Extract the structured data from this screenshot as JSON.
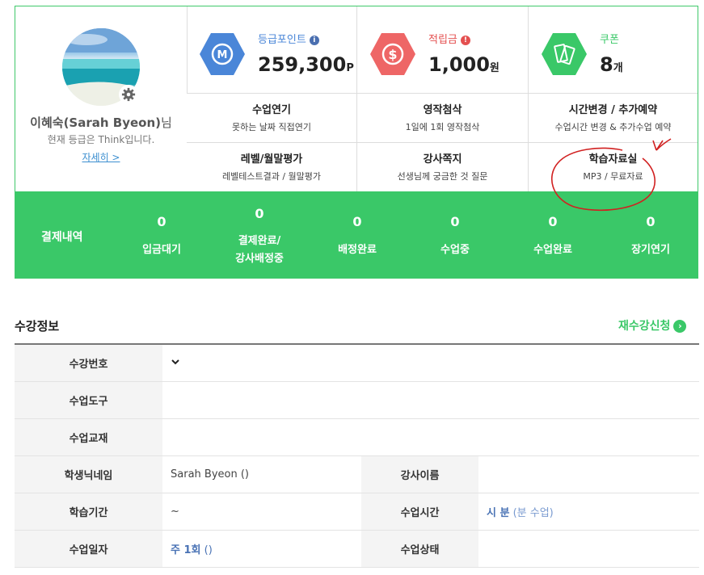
{
  "profile": {
    "name": "이혜숙(Sarah Byeon)",
    "name_suffix": "님",
    "grade_text": "현재 등급은 Think입니다.",
    "detail_link": "자세히 >"
  },
  "stats": [
    {
      "label": "등급포인트",
      "value": "259,300",
      "unit": "P",
      "icon": "m-hexagon-icon",
      "color": "#4a86d8",
      "label_color": "#4a86d8"
    },
    {
      "label": "적립금",
      "value": "1,000",
      "unit": "원",
      "icon": "dollar-hexagon-icon",
      "color": "#ee6666",
      "label_color": "#e45050"
    },
    {
      "label": "쿠폰",
      "value": "8",
      "unit": "개",
      "icon": "coupon-hexagon-icon",
      "color": "#3ac868",
      "label_color": "#3ac868"
    }
  ],
  "menu": [
    {
      "title": "수업연기",
      "sub": "못하는 날짜 직접연기"
    },
    {
      "title": "영작첨삭",
      "sub": "1일에 1회 영작첨삭"
    },
    {
      "title": "시간변경 / 추가예약",
      "sub": "수업시간 변경 & 추가수업 예약"
    },
    {
      "title": "레벨/월말평가",
      "sub": "레벨테스트결과 / 월말평가"
    },
    {
      "title": "강사쪽지",
      "sub": "선생님께 궁금한 것 질문"
    },
    {
      "title": "학습자료실",
      "sub": "MP3 / 무료자료"
    }
  ],
  "payment": {
    "label": "결제내역",
    "items": [
      {
        "count": "0",
        "label": "입금대기"
      },
      {
        "count": "0",
        "label": "결제완료/",
        "label2": "강사배정중"
      },
      {
        "count": "0",
        "label": "배정완료"
      },
      {
        "count": "0",
        "label": "수업중"
      },
      {
        "count": "0",
        "label": "수업완료"
      },
      {
        "count": "0",
        "label": "장기연기"
      }
    ]
  },
  "course": {
    "title": "수강정보",
    "reenroll": "재수강신청",
    "rows": {
      "course_no": {
        "label": "수강번호",
        "value": ""
      },
      "tool": {
        "label": "수업도구",
        "value": ""
      },
      "textbook": {
        "label": "수업교재",
        "value": ""
      },
      "nickname": {
        "label": "학생닉네임",
        "value": "Sarah Byeon ()"
      },
      "teacher": {
        "label": "강사이름",
        "value": ""
      },
      "period": {
        "label": "학습기간",
        "value": "~"
      },
      "class_time": {
        "label": "수업시간",
        "value": "시 분",
        "extra": "(분 수업)"
      },
      "days": {
        "label": "수업일자",
        "value": "주 1회",
        "extra": "()"
      },
      "status": {
        "label": "수업상태",
        "value": ""
      }
    }
  }
}
